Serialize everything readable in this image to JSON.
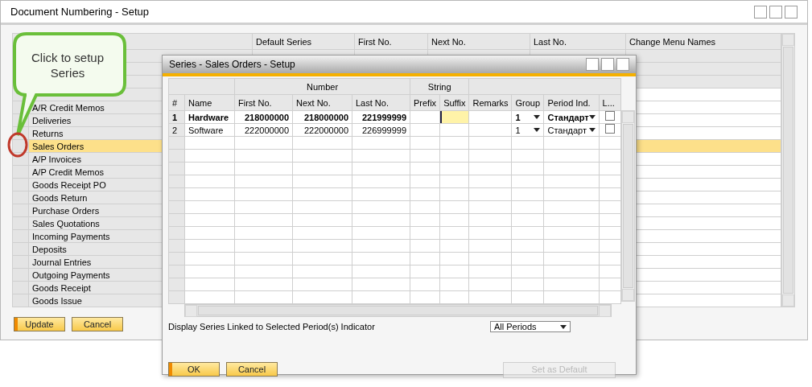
{
  "window": {
    "title": "Document Numbering - Setup"
  },
  "documents": {
    "columns": [
      "",
      "Default Series",
      "First No.",
      "Next No.",
      "Last No.",
      "Change Menu Names"
    ],
    "rows": [
      {
        "selected": false,
        "disabled": true
      },
      {
        "selected": false,
        "disabled": true
      },
      {
        "selected": false,
        "disabled": true
      },
      {
        "selected": false,
        "disabled": false
      },
      {
        "document": "A/R Credit Memos",
        "selected": false,
        "disabled": false
      },
      {
        "document": "Deliveries",
        "selected": false,
        "disabled": false
      },
      {
        "document": "Returns",
        "selected": false,
        "disabled": false
      },
      {
        "document": "Sales Orders",
        "selected": true,
        "disabled": false
      },
      {
        "document": "A/P Invoices",
        "selected": false,
        "disabled": false
      },
      {
        "document": "A/P Credit Memos",
        "selected": false,
        "disabled": false
      },
      {
        "document": "Goods Receipt PO",
        "selected": false,
        "disabled": false
      },
      {
        "document": "Goods Return",
        "selected": false,
        "disabled": false
      },
      {
        "document": "Purchase Orders",
        "selected": false,
        "disabled": false
      },
      {
        "document": "Sales Quotations",
        "selected": false,
        "disabled": false
      },
      {
        "document": "Incoming Payments",
        "selected": false,
        "disabled": false
      },
      {
        "document": "Deposits",
        "selected": false,
        "disabled": false
      },
      {
        "document": "Journal Entries",
        "selected": false,
        "disabled": false
      },
      {
        "document": "Outgoing Payments",
        "selected": false,
        "disabled": false
      },
      {
        "document": "Goods Receipt",
        "selected": false,
        "disabled": false
      },
      {
        "document": "Goods Issue",
        "selected": false,
        "disabled": false
      }
    ]
  },
  "buttons": [
    {
      "label": "Update",
      "focused": true
    },
    {
      "label": "Cancel",
      "focused": false
    }
  ],
  "callout": {
    "text": "Click to setup Series"
  },
  "series_window": {
    "title": "Series - Sales Orders - Setup",
    "column_groups": [
      {
        "columns": [
          "#",
          "Name"
        ]
      },
      {
        "label": "Number",
        "columns": [
          "First No.",
          "Next No.",
          "Last No."
        ]
      },
      {
        "label": "String",
        "columns": [
          "Prefix",
          "Suffix"
        ]
      },
      {
        "columns": [
          "Remarks",
          "Group",
          "Period Ind.",
          "L..."
        ]
      }
    ],
    "rows": [
      {
        "number": "1",
        "name": "Hardware",
        "first_no": "218000000",
        "next_no": "218000000",
        "last_no": "221999999",
        "group": "1",
        "period_ind": "Стандарт",
        "checked": false,
        "default": true,
        "suffix_focused": true
      },
      {
        "number": "2",
        "name": "Software",
        "first_no": "222000000",
        "next_no": "222000000",
        "last_no": "226999999",
        "group": "1",
        "period_ind": "Стандарт",
        "checked": false,
        "default": false,
        "suffix_focused": false
      }
    ],
    "filter": {
      "label": "Display Series Linked to Selected Period(s) Indicator",
      "value": "All Periods"
    },
    "buttons": [
      {
        "label": "OK",
        "focused": true,
        "disabled": false
      },
      {
        "label": "Cancel",
        "focused": false,
        "disabled": false
      },
      {
        "label": "Set as Default",
        "focused": false,
        "disabled": true
      }
    ]
  }
}
